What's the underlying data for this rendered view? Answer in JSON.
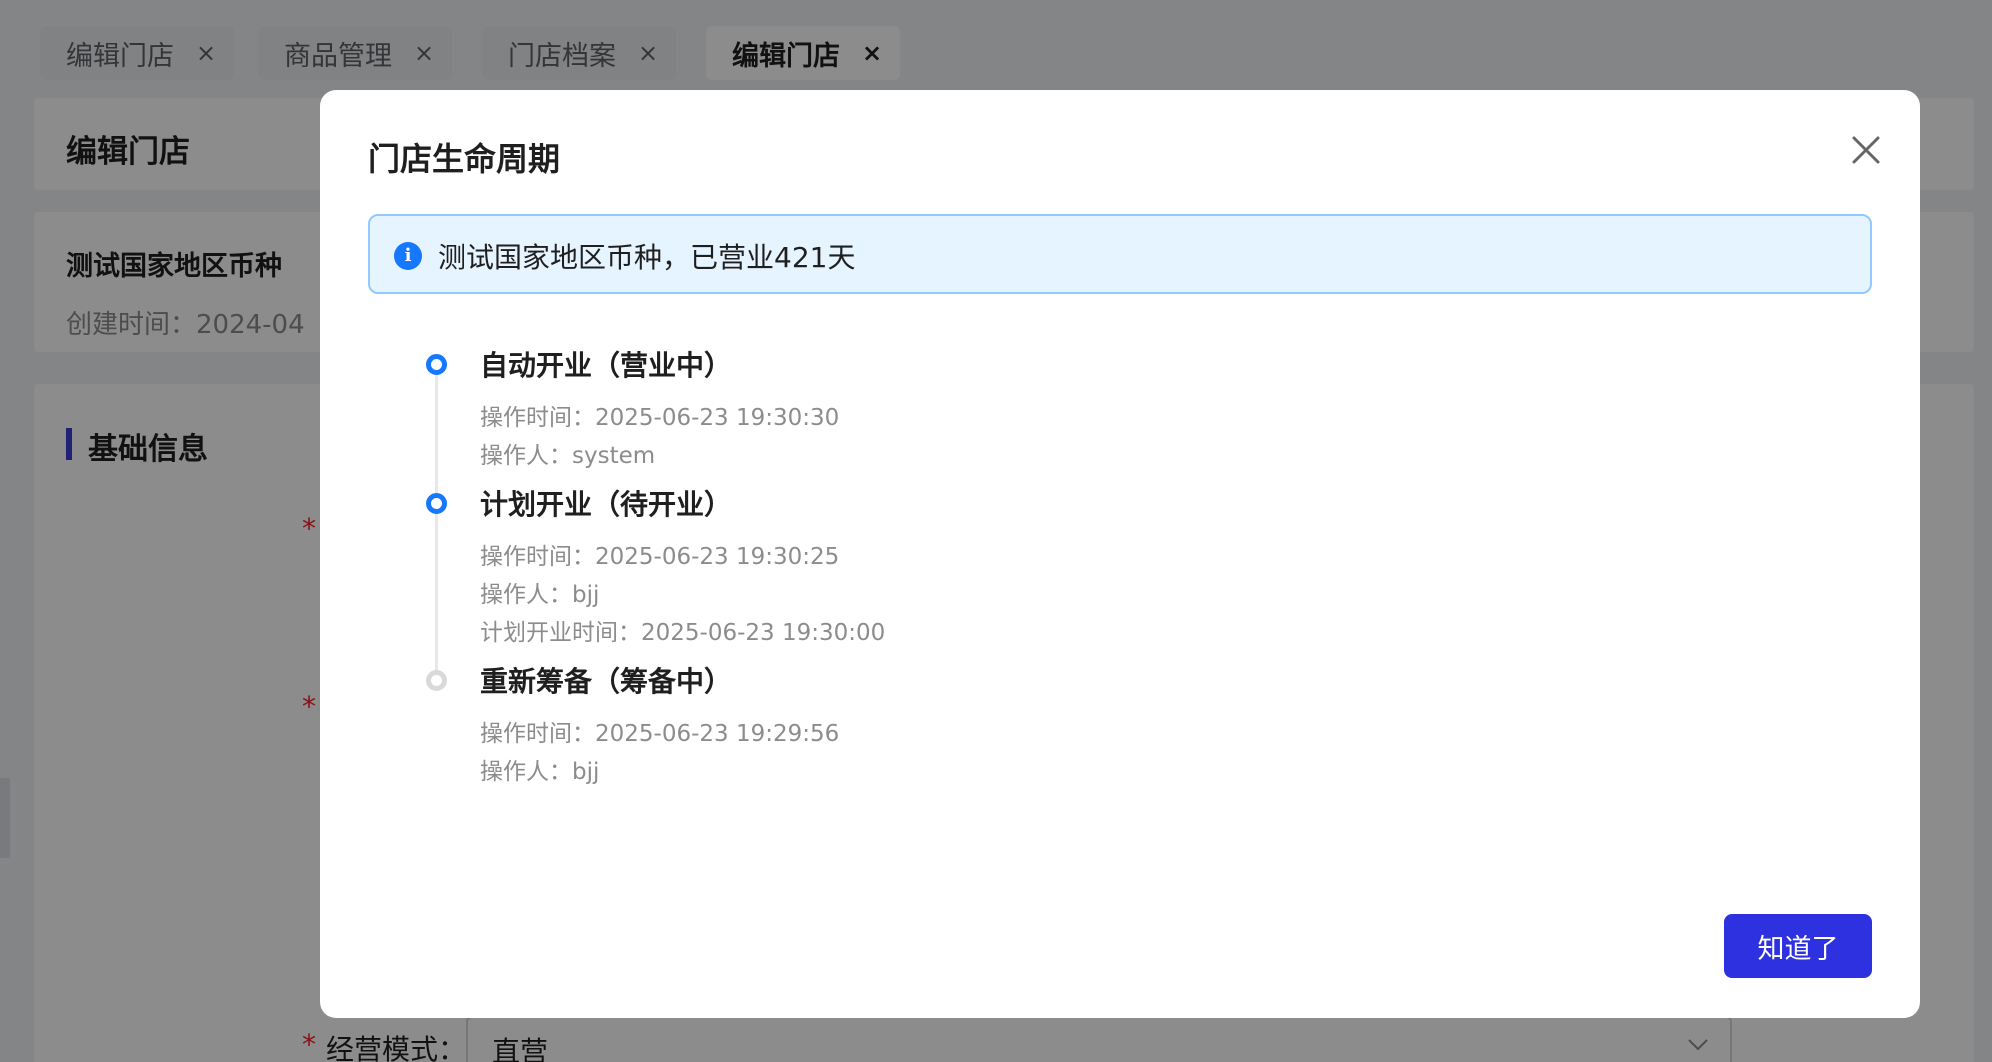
{
  "tabs": [
    {
      "label": "编辑门店",
      "close": "×"
    },
    {
      "label": "商品管理",
      "close": "×"
    },
    {
      "label": "门店档案",
      "close": "×"
    },
    {
      "label": "编辑门店",
      "close": "×"
    }
  ],
  "page": {
    "title": "编辑门店",
    "store_name": "测试国家地区币种",
    "created_label": "创建时间：2024-04",
    "section_title": "基础信息",
    "required_mark": "*",
    "mode_label": "经营模式：",
    "mode_value": "直营"
  },
  "modal": {
    "title": "门店生命周期",
    "alert_icon": "i",
    "alert_text": "测试国家地区币种，已营业421天",
    "timeline": [
      {
        "title": "自动开业（营业中）",
        "lines": [
          "操作时间：2025-06-23 19:30:30",
          "操作人：system"
        ],
        "status": "active"
      },
      {
        "title": "计划开业（待开业）",
        "lines": [
          "操作时间：2025-06-23 19:30:25",
          "操作人：bjj",
          "计划开业时间：2025-06-23 19:30:00"
        ],
        "status": "active"
      },
      {
        "title": "重新筹备（筹备中）",
        "lines": [
          "操作时间：2025-06-23 19:29:56",
          "操作人：bjj"
        ],
        "status": "inactive"
      }
    ],
    "ok_label": "知道了"
  },
  "colors": {
    "primary": "#2e31e0",
    "timeline_active": "#1677ff",
    "timeline_inactive": "#d9d9d9",
    "alert_bg": "#e6f4ff",
    "required": "#f5222d"
  }
}
